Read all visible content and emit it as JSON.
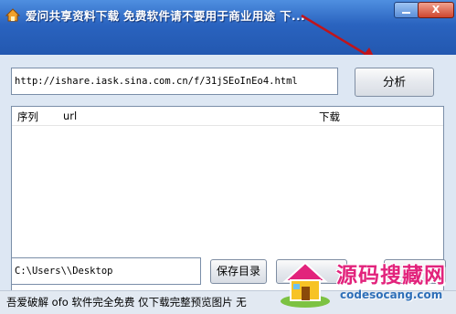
{
  "window": {
    "title": "爱问共享资料下载 免费软件请不要用于商业用途 下...",
    "close_label": "X"
  },
  "url_field": {
    "value": "http://ishare.iask.sina.com.cn/f/31jSEoInEo4.html"
  },
  "analyze_button": {
    "label": "分析"
  },
  "list": {
    "columns": [
      "序列",
      "url",
      "下载"
    ]
  },
  "path_field": {
    "value": "C:\\Users\\\\Desktop"
  },
  "save_button": {
    "label": "保存目录"
  },
  "status_bar": {
    "text": "吾爱破解 ofo 软件完全免费 仅下载完整预览图片 无"
  },
  "watermark": {
    "name": "源码搜藏网",
    "url": "codesocang.com"
  },
  "colors": {
    "titlebar": "#2a63bf",
    "arrow": "#c0141b",
    "watermark": "#e2237c"
  }
}
